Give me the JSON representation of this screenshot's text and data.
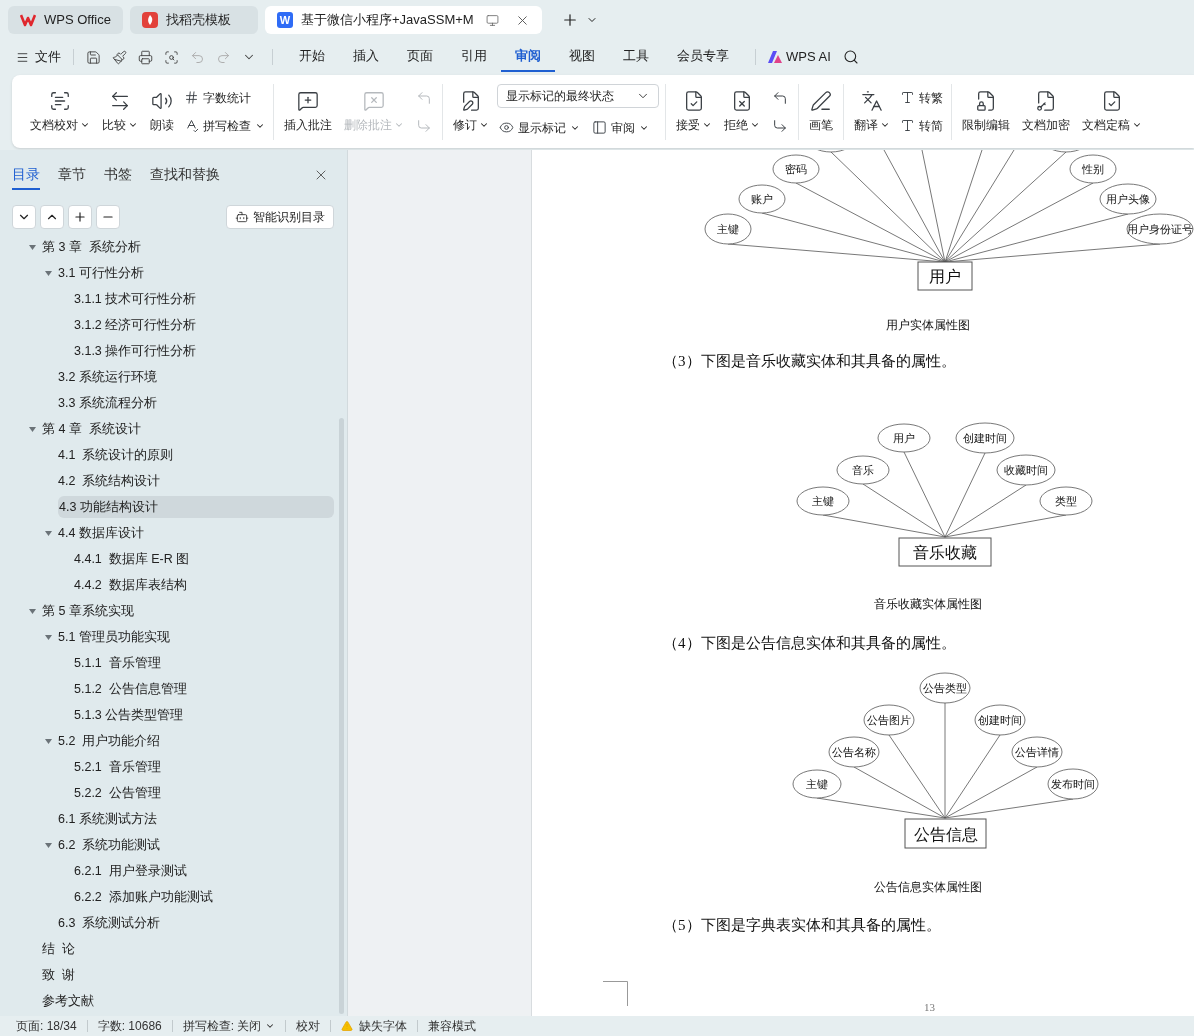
{
  "tabs": [
    {
      "label": "WPS Office",
      "kind": "home",
      "selected": false
    },
    {
      "label": "找稻壳模板",
      "kind": "template",
      "selected": false
    },
    {
      "label": "基于微信小程序+JavaSSM+M",
      "kind": "document",
      "icon_text": "W",
      "selected": true
    }
  ],
  "menu": {
    "file": "文件",
    "items": [
      {
        "label": "开始",
        "selected": false
      },
      {
        "label": "插入",
        "selected": false
      },
      {
        "label": "页面",
        "selected": false
      },
      {
        "label": "引用",
        "selected": false
      },
      {
        "label": "审阅",
        "selected": true
      },
      {
        "label": "视图",
        "selected": false
      },
      {
        "label": "工具",
        "selected": false
      },
      {
        "label": "会员专享",
        "selected": false
      }
    ],
    "ai": "WPS AI"
  },
  "ribbon": {
    "groups": [
      [
        {
          "kind": "large",
          "label": "文档校对",
          "dropdown": true,
          "disabled": false
        },
        {
          "kind": "large",
          "label": "比较",
          "dropdown": true,
          "disabled": false
        },
        {
          "kind": "large",
          "label": "朗读",
          "dropdown": false,
          "disabled": false
        },
        {
          "kind": "small",
          "label": "字数统计",
          "dropdown": false,
          "disabled": false
        },
        {
          "kind": "small",
          "label": "拼写检查",
          "dropdown": true,
          "disabled": false
        }
      ],
      [
        {
          "kind": "large",
          "label": "插入批注",
          "dropdown": false,
          "disabled": false
        },
        {
          "kind": "large",
          "label": "删除批注",
          "dropdown": true,
          "disabled": true
        },
        {
          "kind": "icon",
          "disabled": true
        },
        {
          "kind": "icon",
          "disabled": true
        }
      ],
      [
        {
          "kind": "large",
          "label": "修订",
          "dropdown": true,
          "disabled": false
        },
        {
          "kind": "select",
          "value": "显示标记的最终状态",
          "dropdown": true,
          "disabled": false
        },
        {
          "kind": "small",
          "label": "显示标记",
          "dropdown": true,
          "disabled": false
        },
        {
          "kind": "small",
          "label": "审阅",
          "dropdown": true,
          "disabled": false
        }
      ],
      [
        {
          "kind": "large",
          "label": "接受",
          "dropdown": true,
          "disabled": false
        },
        {
          "kind": "large",
          "label": "拒绝",
          "dropdown": true,
          "disabled": false
        },
        {
          "kind": "icon",
          "disabled": false
        },
        {
          "kind": "icon",
          "disabled": false
        }
      ],
      [
        {
          "kind": "large",
          "label": "画笔",
          "dropdown": false,
          "disabled": false
        }
      ],
      [
        {
          "kind": "large",
          "label": "翻译",
          "dropdown": true,
          "disabled": false
        },
        {
          "kind": "small",
          "label": "转繁",
          "dropdown": false,
          "disabled": false
        },
        {
          "kind": "small",
          "label": "转简",
          "dropdown": false,
          "disabled": false
        }
      ],
      [
        {
          "kind": "large",
          "label": "限制编辑",
          "dropdown": false,
          "disabled": false
        },
        {
          "kind": "large",
          "label": "文档加密",
          "dropdown": false,
          "disabled": false
        },
        {
          "kind": "large",
          "label": "文档定稿",
          "dropdown": true,
          "disabled": false
        }
      ]
    ]
  },
  "sidebar": {
    "tabs": [
      {
        "label": "目录",
        "selected": true
      },
      {
        "label": "章节",
        "selected": false
      },
      {
        "label": "书签",
        "selected": false
      },
      {
        "label": "查找和替换",
        "selected": false
      }
    ],
    "smart_button": "智能识别目录",
    "toc": [
      {
        "label": "第 3 章  系统分析",
        "selected": false,
        "expanded": true,
        "children": [
          {
            "label": "3.1 可行性分析",
            "selected": false,
            "expanded": true,
            "children": [
              {
                "label": "3.1.1 技术可行性分析",
                "selected": false
              },
              {
                "label": "3.1.2 经济可行性分析",
                "selected": false
              },
              {
                "label": "3.1.3 操作可行性分析",
                "selected": false
              }
            ]
          },
          {
            "label": "3.2 系统运行环境",
            "selected": false
          },
          {
            "label": "3.3 系统流程分析",
            "selected": false
          }
        ]
      },
      {
        "label": "第 4 章  系统设计",
        "selected": false,
        "expanded": true,
        "children": [
          {
            "label": "4.1  系统设计的原则",
            "selected": false
          },
          {
            "label": "4.2  系统结构设计",
            "selected": false
          },
          {
            "label": "4.3 功能结构设计",
            "selected": true
          },
          {
            "label": "4.4 数据库设计",
            "selected": false,
            "expanded": true,
            "children": [
              {
                "label": "4.4.1  数据库 E-R 图",
                "selected": false
              },
              {
                "label": "4.4.2  数据库表结构",
                "selected": false
              }
            ]
          }
        ]
      },
      {
        "label": "第 5 章系统实现",
        "selected": false,
        "expanded": true,
        "children": [
          {
            "label": "5.1 管理员功能实现",
            "selected": false,
            "expanded": true,
            "children": [
              {
                "label": "5.1.1  音乐管理",
                "selected": false
              },
              {
                "label": "5.1.2  公告信息管理",
                "selected": false
              },
              {
                "label": "5.1.3 公告类型管理",
                "selected": false
              }
            ]
          },
          {
            "label": "5.2  用户功能介绍",
            "selected": false,
            "expanded": true,
            "children": [
              {
                "label": "5.2.1  音乐管理",
                "selected": false
              },
              {
                "label": "5.2.2  公告管理",
                "selected": false
              }
            ]
          },
          {
            "label": "6.1 系统测试方法",
            "selected": false
          },
          {
            "label": "6.2  系统功能测试",
            "selected": false,
            "expanded": true,
            "children": [
              {
                "label": "6.2.1  用户登录测试",
                "selected": false
              },
              {
                "label": "6.2.2  添加账户功能测试",
                "selected": false
              }
            ]
          },
          {
            "label": "6.3  系统测试分析",
            "selected": false
          }
        ]
      },
      {
        "label": "结  论",
        "selected": false
      },
      {
        "label": "致  谢",
        "selected": false
      },
      {
        "label": "参考文献",
        "selected": false
      }
    ]
  },
  "document": {
    "blocks": [
      {
        "kind": "er_diagram",
        "entity": "用户",
        "attributes": [
          "密码",
          "账户",
          "主键",
          "性别",
          "用户头像",
          "用户身份证号"
        ]
      },
      {
        "kind": "caption",
        "text": "用户实体属性图"
      },
      {
        "kind": "paragraph",
        "text": "（3）下图是音乐收藏实体和其具备的属性。"
      },
      {
        "kind": "er_diagram",
        "entity": "音乐收藏",
        "attributes": [
          "主键",
          "音乐",
          "用户",
          "创建时间",
          "收藏时间",
          "类型"
        ]
      },
      {
        "kind": "caption",
        "text": "音乐收藏实体属性图"
      },
      {
        "kind": "paragraph",
        "text": "（4）下图是公告信息实体和其具备的属性。"
      },
      {
        "kind": "er_diagram",
        "entity": "公告信息",
        "attributes": [
          "主键",
          "公告名称",
          "公告图片",
          "公告类型",
          "创建时间",
          "公告详情",
          "发布时间"
        ]
      },
      {
        "kind": "caption",
        "text": "公告信息实体属性图"
      },
      {
        "kind": "paragraph",
        "text": "（5）下图是字典表实体和其具备的属性。"
      }
    ],
    "page_number": "13"
  },
  "status_bar": {
    "page": "页面: 18/34",
    "words": "字数: 10686",
    "spell": "拼写检查: 关闭",
    "proof": "校对",
    "missing_font": "缺失字体",
    "compat": "兼容模式"
  }
}
